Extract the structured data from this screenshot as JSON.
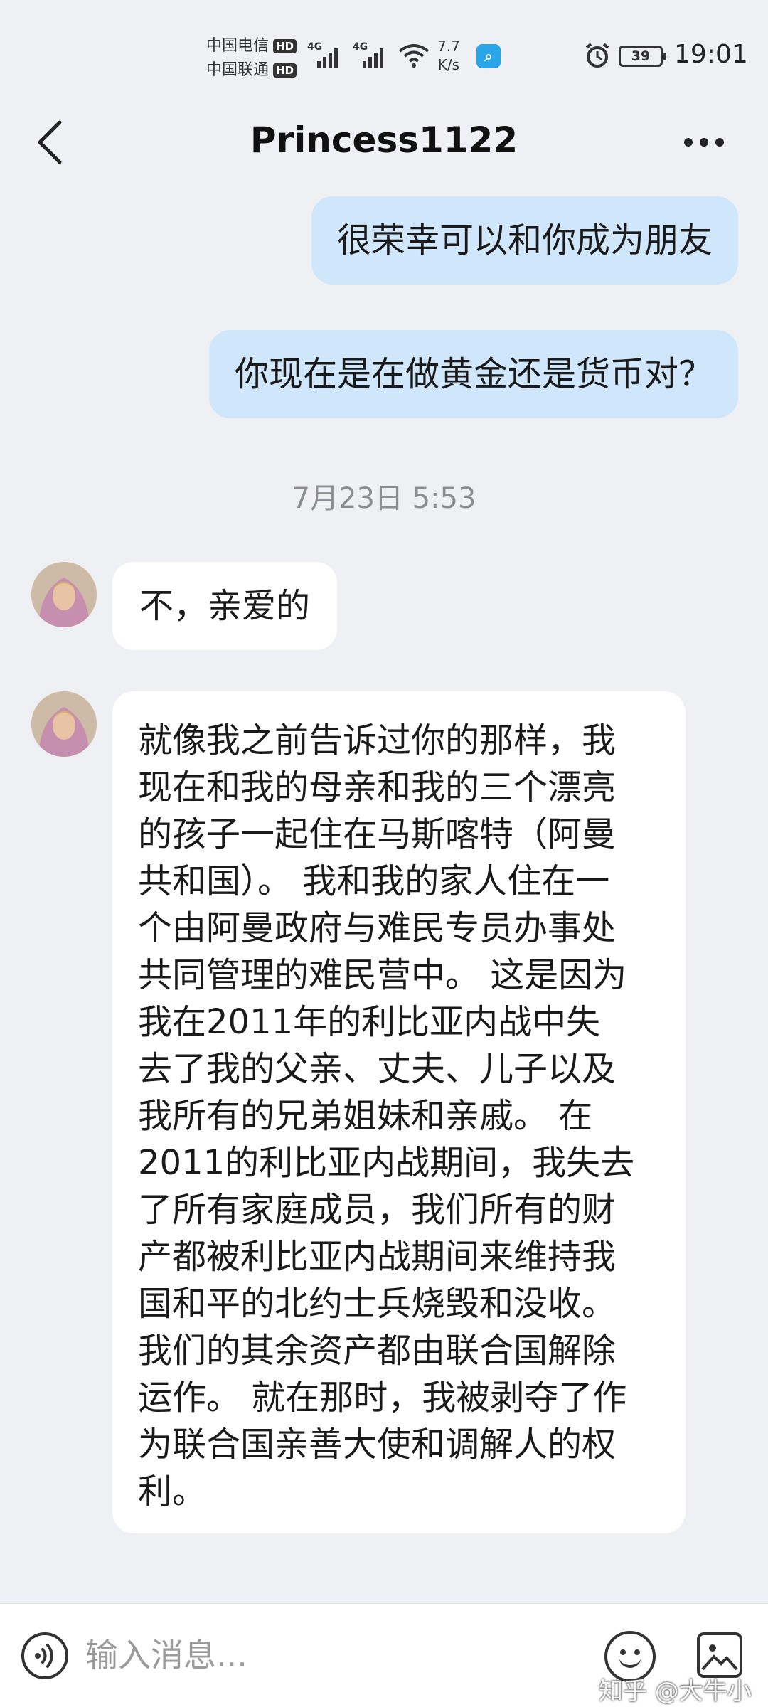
{
  "status_bar": {
    "carrier_1": "中国电信",
    "carrier_2": "中国联通",
    "hd": "HD",
    "network_type": "4G",
    "speed_value": "7.7",
    "speed_unit": "K/s",
    "battery": "39",
    "time": "19:01"
  },
  "header": {
    "title": "Princess1122"
  },
  "messages": {
    "out_1": "很荣幸可以和你成为朋友",
    "out_2": "你现在是在做黄金还是货币对？",
    "timestamp": "7月23日 5:53",
    "in_1": "不，亲爱的",
    "in_2_lines": [
      "就像我之前告诉过你的那样，我",
      "现在和我的母亲和我的三个漂亮",
      "的孩子一起住在马斯喀特（阿曼",
      "共和国）。 我和我的家人住在一",
      "个由阿曼政府与难民专员办事处",
      "共同管理的难民营中。 这是因为",
      "我在2011年的利比亚内战中失",
      "去了我的父亲、丈夫、儿子以及",
      "我所有的兄弟姐妹和亲戚。 在",
      "2011的利比亚内战期间，我失去",
      "了所有家庭成员，我们所有的财",
      "产都被利比亚内战期间来维持我",
      "国和平的北约士兵烧毁和没收。",
      "我们的其余资产都由联合国解除",
      "运作。 就在那时，我被剥夺了作",
      "为联合国亲善大使和调解人的权",
      "利。"
    ]
  },
  "input_bar": {
    "placeholder": "输入消息..."
  },
  "watermark": "知乎 @大牛小超"
}
